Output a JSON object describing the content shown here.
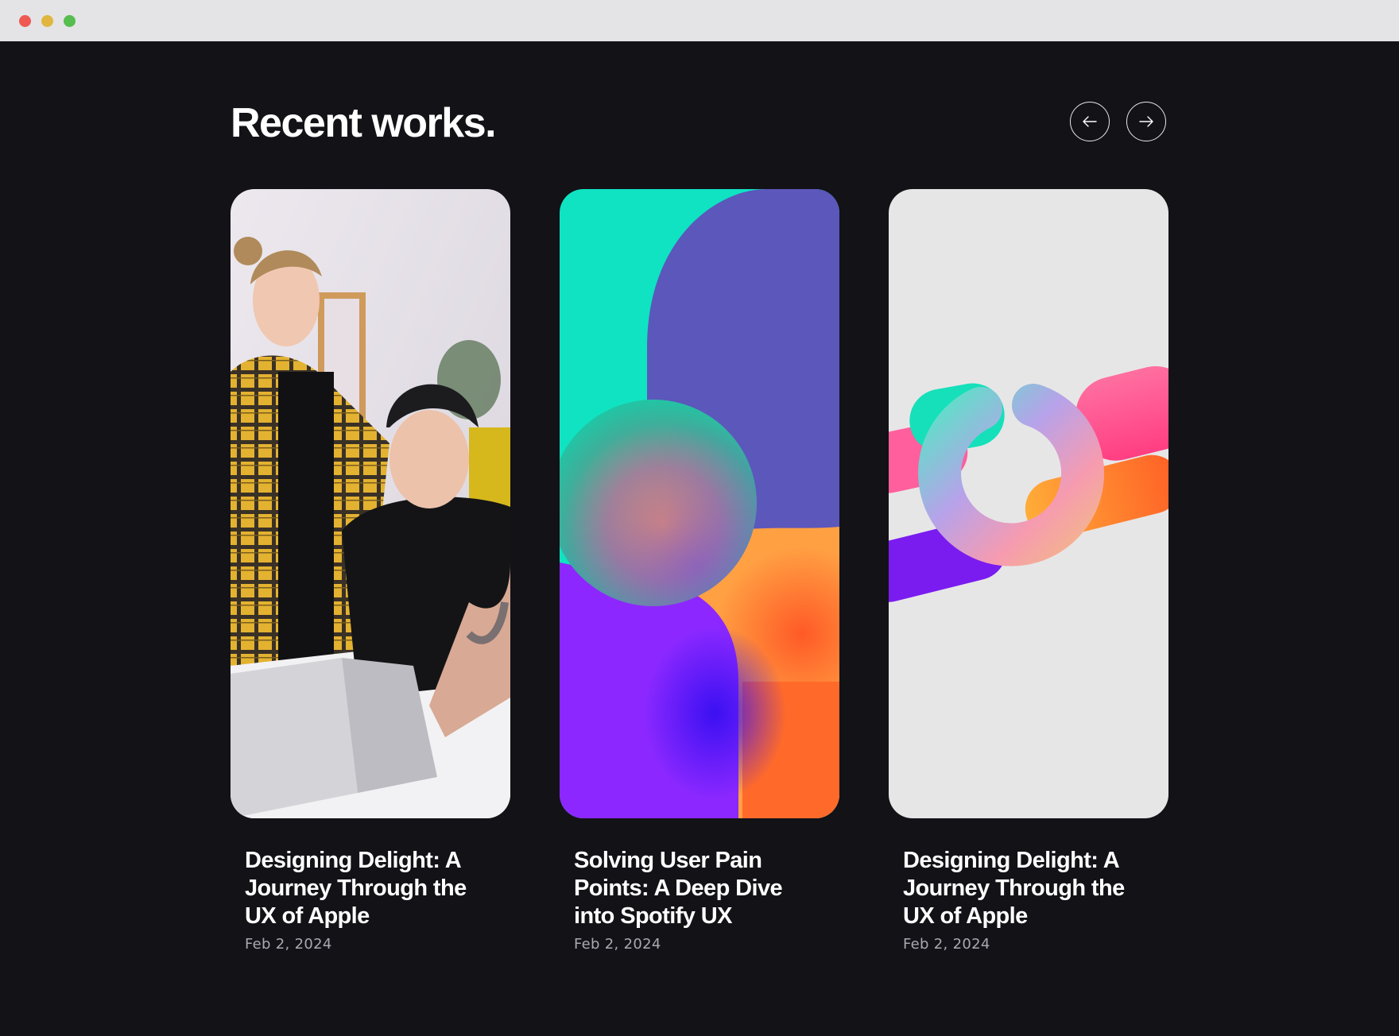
{
  "section": {
    "heading": "Recent works."
  },
  "nav": {
    "prev_icon": "arrow-left-icon",
    "next_icon": "arrow-right-icon"
  },
  "cards": [
    {
      "title": "Designing Delight: A Journey Through the UX of Apple",
      "date": "Feb 2, 2024",
      "image": "photo-two-people-at-laptop"
    },
    {
      "title": "Solving User Pain Points: A Deep Dive into Spotify UX",
      "date": "Feb 2, 2024",
      "image": "abstract-gradient-shapes"
    },
    {
      "title": "Designing Delight: A Journey Through the UX of Apple",
      "date": "Feb 2, 2024",
      "image": "3d-pill-shapes-and-ring"
    }
  ],
  "colors": {
    "background": "#121217",
    "heading": "#ffffff",
    "date": "#a9a9b0",
    "window_bar": "#e4e4e6"
  }
}
